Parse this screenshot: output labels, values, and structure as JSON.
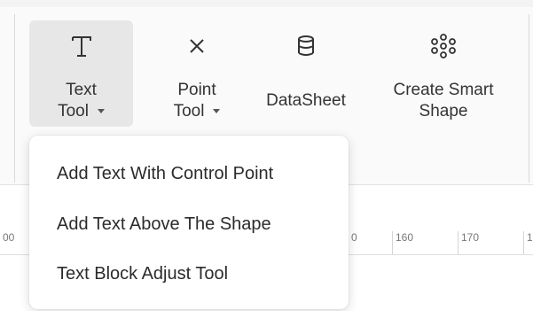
{
  "toolbar": {
    "tools": [
      {
        "label_line1": "Text",
        "label_line2": "Tool",
        "icon": "text-tool-icon"
      },
      {
        "label_line1": "Point",
        "label_line2": "Tool",
        "icon": "point-tool-icon"
      },
      {
        "label": "DataSheet",
        "icon": "datasheet-icon"
      },
      {
        "label_line1": "Create Smart",
        "label_line2": "Shape",
        "icon": "create-smart-shape-icon"
      }
    ]
  },
  "ruler": {
    "ticks": [
      "00",
      "0",
      "160",
      "170",
      "1"
    ]
  },
  "dropdown": {
    "items": [
      "Add Text With Control Point",
      "Add Text Above The Shape",
      "Text Block Adjust Tool"
    ]
  },
  "colors": {
    "toolbar_bg": "#fafafa",
    "active_tool_bg": "#e7e7e7",
    "menu_bg": "#ffffff",
    "text": "#2b2b2b"
  }
}
